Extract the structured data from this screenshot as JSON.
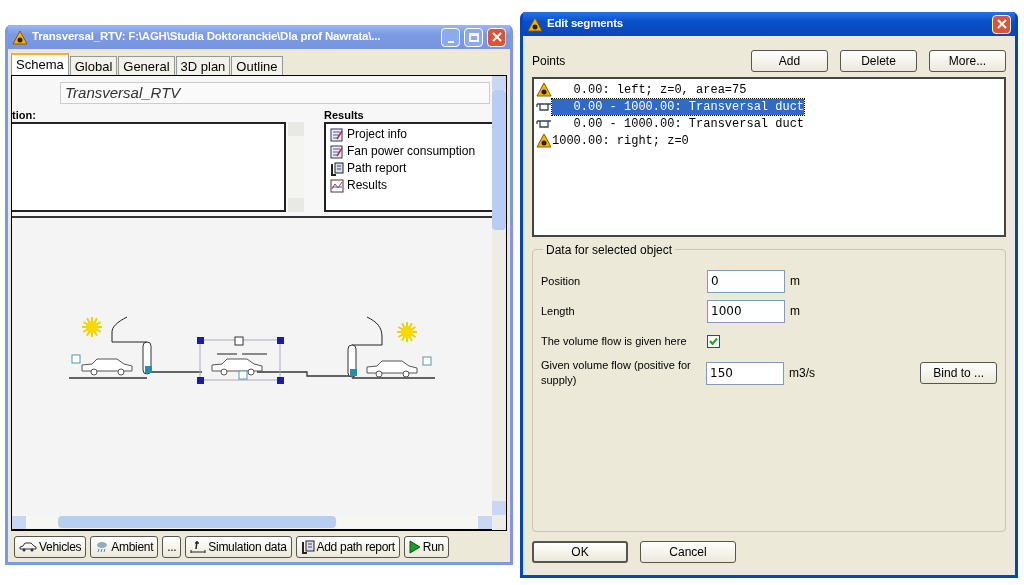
{
  "main_window": {
    "title": "Transversal_RTV: F:\\AGH\\Studia Doktoranckie\\Dla prof Nawrata\\...",
    "active": false,
    "tabs": [
      {
        "label": "Schema",
        "selected": true
      },
      {
        "label": "Global",
        "selected": false
      },
      {
        "label": "General",
        "selected": false
      },
      {
        "label": "3D plan",
        "selected": false
      },
      {
        "label": "Outline",
        "selected": false
      }
    ],
    "project_name": "Transversal_RTV",
    "description_label": "tion:",
    "results": {
      "title": "Results",
      "items": [
        {
          "label": "Project info",
          "kind": "report"
        },
        {
          "label": "Fan power consumption",
          "kind": "report"
        },
        {
          "label": "Path report",
          "kind": "path"
        },
        {
          "label": "Results",
          "kind": "chart"
        }
      ]
    },
    "buttons": [
      {
        "label": "Vehicles",
        "kind": "car"
      },
      {
        "label": "Ambient",
        "kind": "weather"
      },
      {
        "label": "...",
        "kind": "plain"
      },
      {
        "label": "Simulation data",
        "kind": "time"
      },
      {
        "label": "Add path report",
        "kind": "path"
      },
      {
        "label": "Run",
        "kind": "play"
      }
    ]
  },
  "dialog": {
    "title": "Edit segments",
    "active": true,
    "points_label": "Points",
    "toolbar_buttons": [
      "Add",
      "Delete",
      "More..."
    ],
    "points": [
      {
        "kind": "portal",
        "text": "   0.00: left; z=0, area=75",
        "selected": false
      },
      {
        "kind": "duct",
        "text": "   0.00 - 1000.00: Transversal duct",
        "selected": true
      },
      {
        "kind": "duct",
        "text": "   0.00 - 1000.00: Transversal duct",
        "selected": false
      },
      {
        "kind": "portal",
        "text": "1000.00: right; z=0",
        "selected": false
      }
    ],
    "group_title": "Data for selected object",
    "rows": [
      {
        "kind": "field",
        "label": "Position",
        "value": "0",
        "unit": "m"
      },
      {
        "kind": "field",
        "label": "Length",
        "value": "1000",
        "unit": "m"
      },
      {
        "kind": "checkbox",
        "label": "The volume flow is given here",
        "checked": true
      },
      {
        "kind": "field",
        "label": "Given volume flow (positive for supply)",
        "value": "150",
        "unit": "m3/s",
        "button": "Bind to ..."
      }
    ],
    "buttons": [
      "OK",
      "Cancel"
    ]
  }
}
